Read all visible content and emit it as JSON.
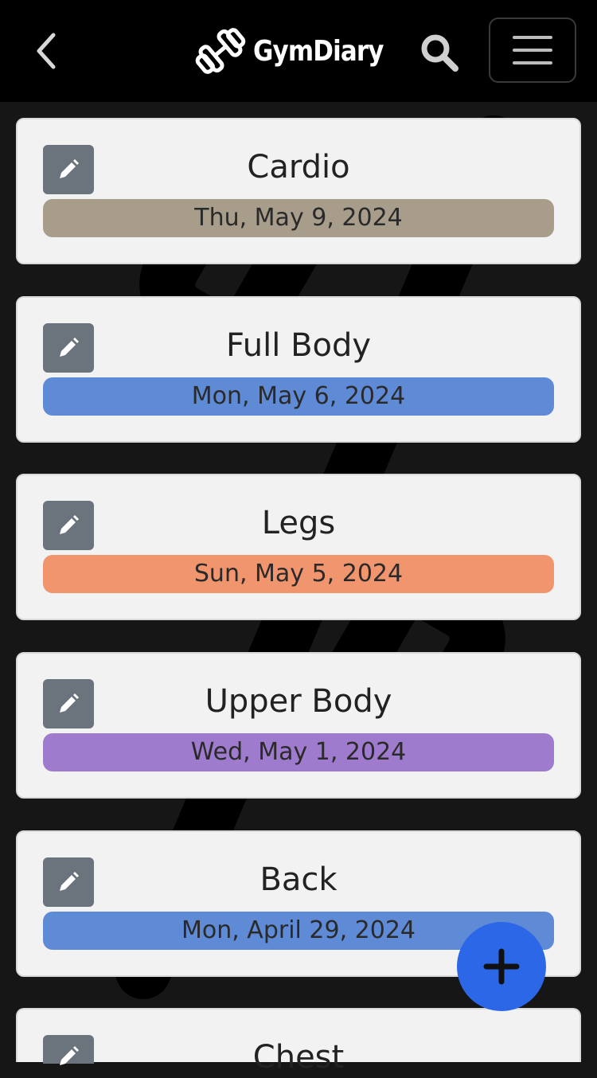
{
  "app": {
    "brand_name": "GymDiary",
    "icons": {
      "back": "chevron-left-icon",
      "logo": "dumbbell-icon",
      "search": "search-icon",
      "menu": "hamburger-menu-icon",
      "edit": "pencil-icon",
      "add": "plus-icon"
    }
  },
  "workouts": [
    {
      "title": "Cardio",
      "date": "Thu, May 9, 2024",
      "color": "#a89d8b"
    },
    {
      "title": "Full Body",
      "date": "Mon, May 6, 2024",
      "color": "#5f8ad6"
    },
    {
      "title": "Legs",
      "date": "Sun, May 5, 2024",
      "color": "#f0956d"
    },
    {
      "title": "Upper Body",
      "date": "Wed, May 1, 2024",
      "color": "#9f7bcd"
    },
    {
      "title": "Back",
      "date": "Mon, April 29, 2024",
      "color": "#5f8ad6"
    },
    {
      "title": "Chest",
      "date": "",
      "color": "#5f8ad6"
    }
  ],
  "colors": {
    "header_bg": "#000000",
    "page_bg": "#161616",
    "card_bg": "#f2f2f2",
    "edit_button": "#6b737c",
    "fab": "#2c67e8"
  }
}
